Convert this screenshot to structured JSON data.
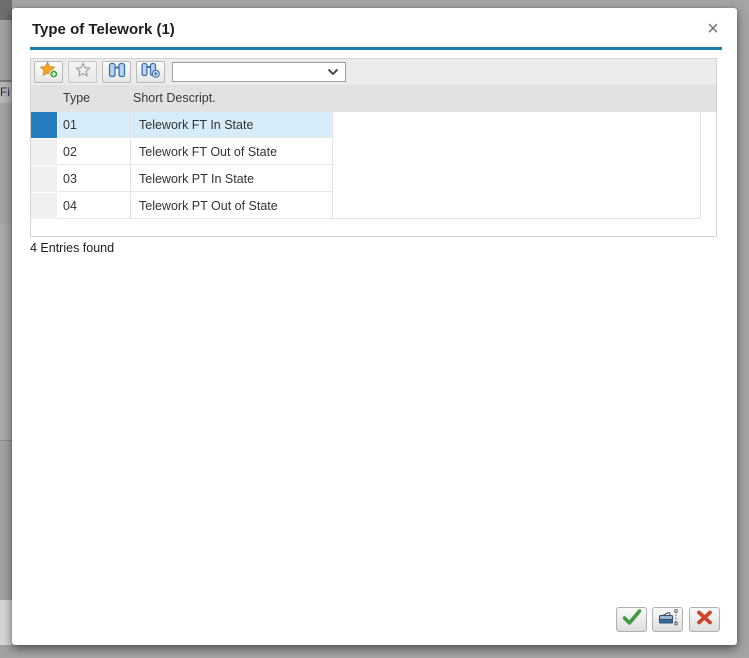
{
  "window": {
    "title": "Type of Telework (1)",
    "close_icon": "×"
  },
  "toolbar": {
    "buttons": [
      {
        "name": "insert-in-personal-list",
        "icon": "star-plus-icon",
        "enabled": true
      },
      {
        "name": "delete-from-personal-list",
        "icon": "star-disabled-icon",
        "enabled": false
      },
      {
        "name": "find",
        "icon": "binoculars-icon",
        "enabled": true
      },
      {
        "name": "find-next",
        "icon": "binoculars-plus-icon",
        "enabled": true
      }
    ],
    "restriction_dropdown": {
      "value": "",
      "icon": "chevron-down-icon"
    }
  },
  "table": {
    "columns": [
      "Type",
      "Short Descript."
    ],
    "rows": [
      {
        "type": "01",
        "short_descript": "Telework FT In State",
        "selected": true
      },
      {
        "type": "02",
        "short_descript": "Telework FT Out of State",
        "selected": false
      },
      {
        "type": "03",
        "short_descript": "Telework PT In State",
        "selected": false
      },
      {
        "type": "04",
        "short_descript": "Telework PT Out of State",
        "selected": false
      }
    ]
  },
  "status_bar": {
    "text": "4 Entries found"
  },
  "footer": {
    "buttons": [
      {
        "name": "accept",
        "icon": "green-check-icon"
      },
      {
        "name": "print",
        "icon": "printer-icon"
      },
      {
        "name": "cancel",
        "icon": "red-x-icon"
      }
    ]
  },
  "background_window": {
    "clipped_text": "Fi"
  },
  "colors": {
    "title_underline": "#1a7ea6",
    "selection_blue": "#237dbe",
    "selected_row_bg": "#d6ecf8",
    "accept_green": "#3f9c3f",
    "cancel_red": "#cc4529"
  }
}
